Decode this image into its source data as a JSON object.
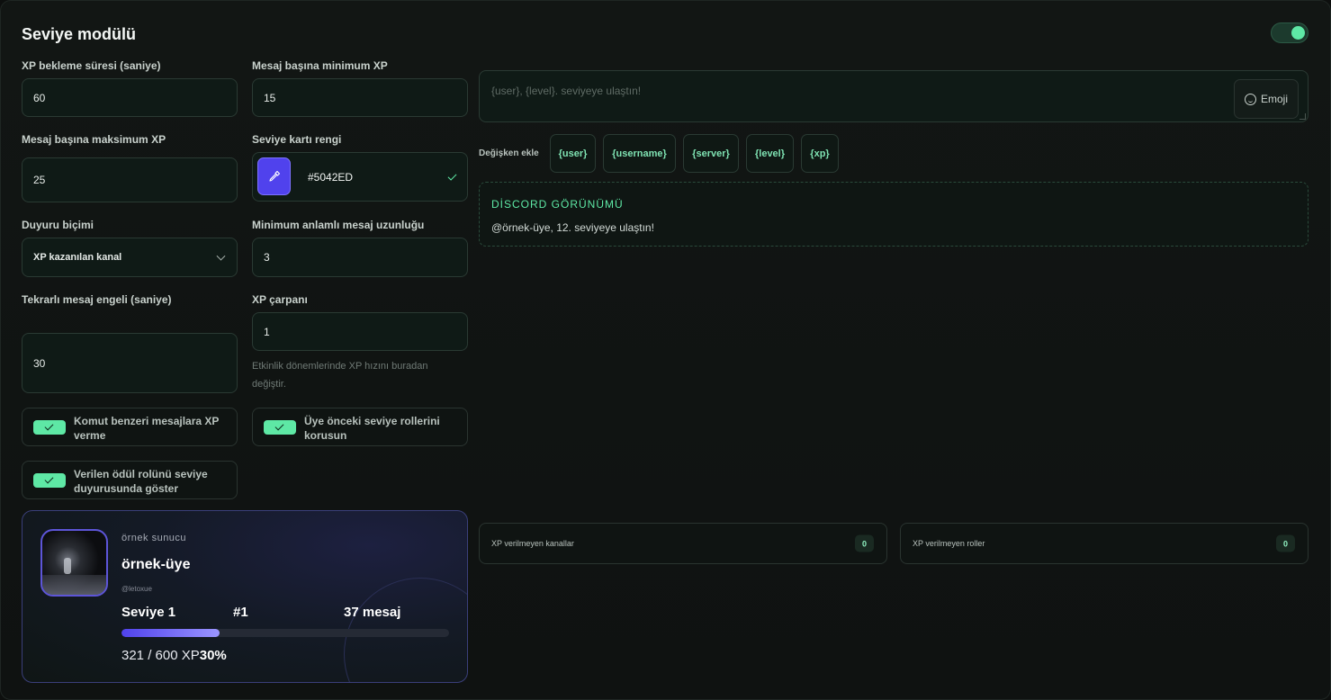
{
  "module": {
    "title": "Seviye modülü",
    "enabled": true,
    "accent_color": "#5ee8a5"
  },
  "fields": {
    "cooldown": {
      "label": "XP bekleme süresi (saniye)",
      "value": "60"
    },
    "min_xp": {
      "label": "Mesaj başına minimum XP",
      "value": "15"
    },
    "max_xp": {
      "label": "Mesaj başına maksimum XP",
      "value": "25"
    },
    "card_color": {
      "label": "Seviye kartı rengi",
      "value": "#5042ED"
    },
    "announce_format": {
      "label": "Duyuru biçimi",
      "value": "XP kazanılan kanal"
    },
    "min_length": {
      "label": "Minimum anlamlı mesaj uzunluğu",
      "value": "3"
    },
    "repeat_block": {
      "label": "Tekrarlı mesaj engeli (saniye)",
      "value": "30"
    },
    "multiplier": {
      "label": "XP çarpanı",
      "value": "1",
      "hint": "Etkinlik dönemlerinde XP hızını buradan değiştir."
    }
  },
  "checkboxes": {
    "no_command_xp": {
      "label": "Komut benzeri mesajlara XP verme",
      "checked": true
    },
    "keep_roles": {
      "label": "Üye önceki seviye rollerini korusun",
      "checked": true
    },
    "show_reward": {
      "label": "Verilen ödül rolünü seviye duyurusunda göster",
      "checked": true
    }
  },
  "message": {
    "placeholder": "{user}, {level}. seviyeye ulaştın!",
    "emoji_label": "Emoji"
  },
  "variables": {
    "label": "Değişken ekle",
    "items": [
      "{user}",
      "{username}",
      "{server}",
      "{level}",
      "{xp}"
    ]
  },
  "preview": {
    "heading": "DİSCORD GÖRÜNÜMÜ",
    "text": "@örnek-üye, 12. seviyeye ulaştın!"
  },
  "exclusions": {
    "channels": {
      "label": "XP verilmeyen kanallar",
      "count": "0"
    },
    "roles": {
      "label": "XP verilmeyen roller",
      "count": "0"
    }
  },
  "card": {
    "server": "örnek sunucu",
    "username": "örnek-üye",
    "handle": "@letoxue",
    "level": "Seviye 1",
    "rank": "#1",
    "messages": "37 mesaj",
    "xp_text": "321 / 600 XP",
    "percent": "30%",
    "progress": 0.3
  }
}
